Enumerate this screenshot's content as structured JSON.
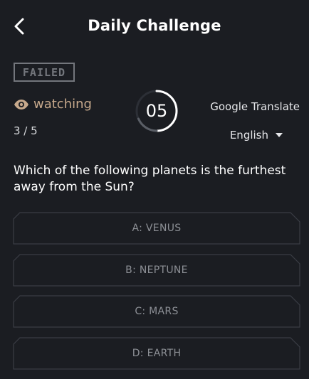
{
  "header": {
    "title": "Daily Challenge",
    "back_icon": "chevron-left-icon"
  },
  "status": {
    "stamp": "FAILED",
    "watching_label": "watching",
    "watching_icon": "eye-icon",
    "progress": "3 / 5"
  },
  "timer": {
    "value": "05"
  },
  "translate": {
    "label": "Google Translate",
    "language": "English"
  },
  "question": {
    "text": "Which of the following planets is the furthest away from the Sun?"
  },
  "options": [
    {
      "label": "A: VENUS"
    },
    {
      "label": "B: NEPTUNE"
    },
    {
      "label": "C: MARS"
    },
    {
      "label": "D: EARTH"
    }
  ],
  "colors": {
    "background": "#1b1d22",
    "watching": "#c7a98c",
    "timer_ring": "#ffffff",
    "option_border": "#3a3d44",
    "option_text": "#8c8f95"
  }
}
